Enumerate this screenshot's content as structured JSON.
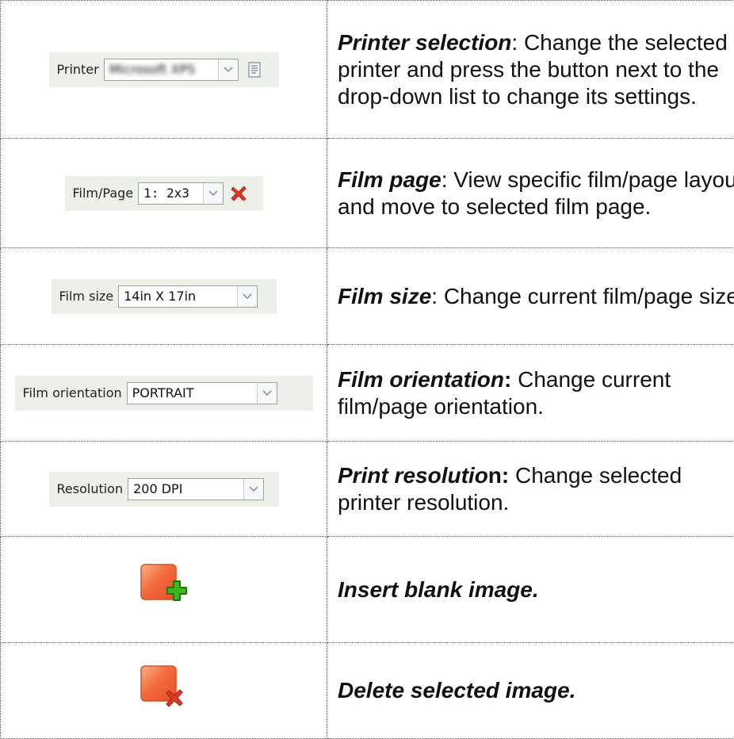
{
  "rows": [
    {
      "control": {
        "label": "Printer",
        "value": "Microsoft XPS",
        "icon": "printer-settings-icon"
      },
      "description": {
        "term": "Printer selection",
        "text": ": Change the selected printer and press the button next to the drop-down list to change its settings."
      }
    },
    {
      "control": {
        "label": "Film/Page",
        "value": "1: 2x3",
        "icon": "remove-page-icon"
      },
      "description": {
        "term": "Film page",
        "text": ": View specific film/page layout and move to selected film page."
      }
    },
    {
      "control": {
        "label": "Film size",
        "value": "14in X 17in"
      },
      "description": {
        "term": "Film size",
        "text": ": Change current film/page size."
      }
    },
    {
      "control": {
        "label": "Film orientation",
        "value": "PORTRAIT"
      },
      "description": {
        "term": "Film orientation",
        "term_suffix": ":",
        "text": " Change current film/page orientation."
      }
    },
    {
      "control": {
        "label": "Resolution",
        "value": "200 DPI"
      },
      "description": {
        "term": "Print resolutio",
        "term_suffix": "n:",
        "text": " Change selected printer resolution."
      }
    },
    {
      "control": {
        "icon": "insert-blank-image-icon"
      },
      "description": {
        "term": "Insert blank image."
      }
    },
    {
      "control": {
        "icon": "delete-image-icon"
      },
      "description": {
        "term": "Delete selected image."
      }
    }
  ],
  "colors": {
    "strip_bg": "#ecf0e8",
    "orange": "#f36b3c",
    "green_plus": "#3cb81e",
    "red_x": "#d8392a"
  }
}
